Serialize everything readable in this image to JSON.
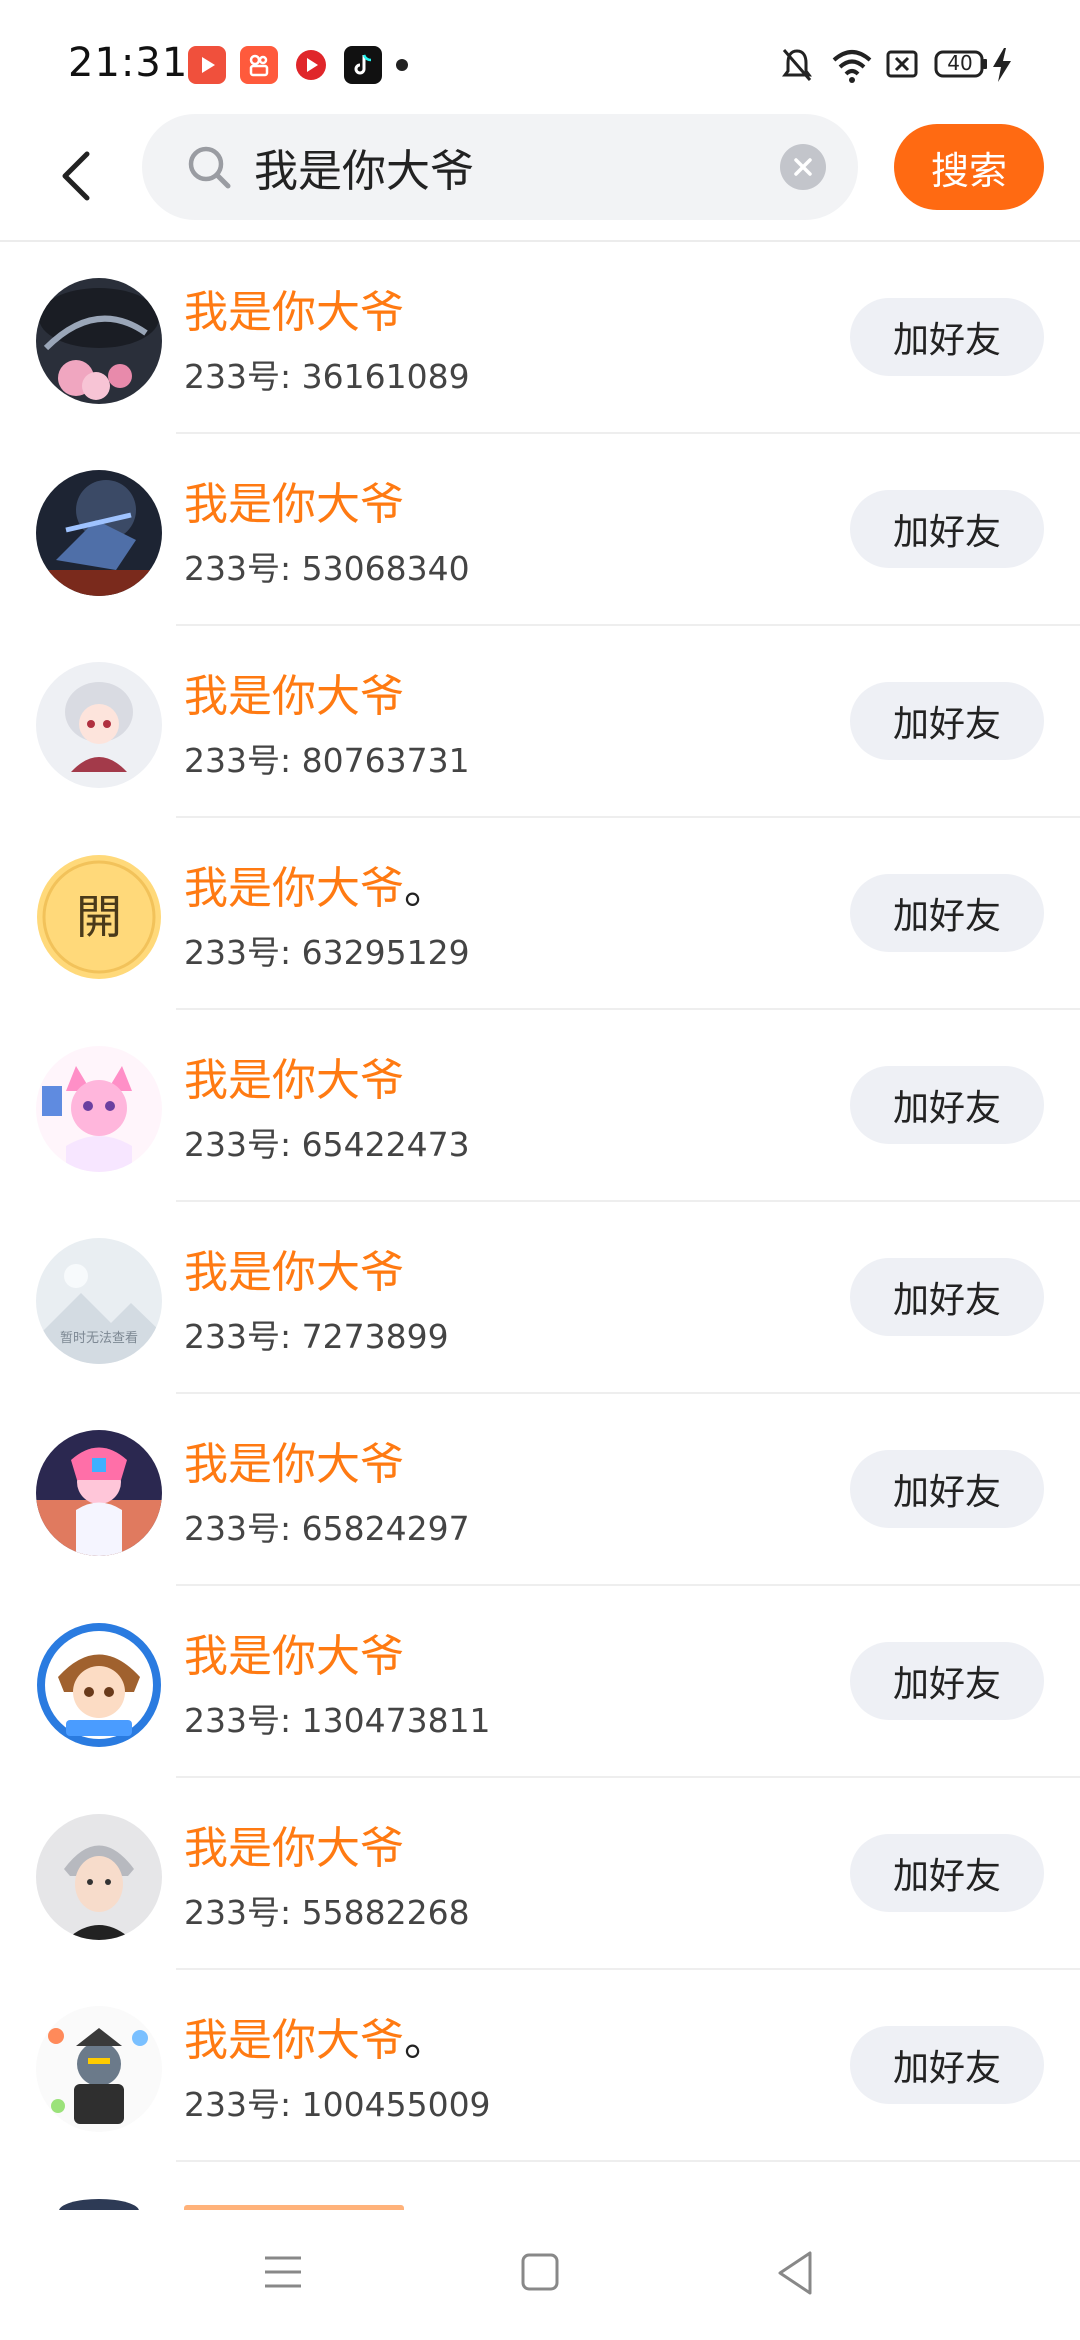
{
  "status": {
    "time": "21:31",
    "battery": "40"
  },
  "search": {
    "query": "我是你大爷",
    "button_label": "搜索"
  },
  "results": [
    {
      "name": "我是你大爷",
      "suffix": "",
      "uid": "233号: 36161089",
      "add_label": "加好友"
    },
    {
      "name": "我是你大爷",
      "suffix": "",
      "uid": "233号: 53068340",
      "add_label": "加好友"
    },
    {
      "name": "我是你大爷",
      "suffix": "",
      "uid": "233号: 80763731",
      "add_label": "加好友"
    },
    {
      "name": "我是你大爷",
      "suffix": "。",
      "uid": "233号: 63295129",
      "add_label": "加好友"
    },
    {
      "name": "我是你大爷",
      "suffix": "",
      "uid": "233号: 65422473",
      "add_label": "加好友"
    },
    {
      "name": "我是你大爷",
      "suffix": "",
      "uid": "233号: 7273899",
      "add_label": "加好友"
    },
    {
      "name": "我是你大爷",
      "suffix": "",
      "uid": "233号: 65824297",
      "add_label": "加好友"
    },
    {
      "name": "我是你大爷",
      "suffix": "",
      "uid": "233号: 130473811",
      "add_label": "加好友"
    },
    {
      "name": "我是你大爷",
      "suffix": "",
      "uid": "233号: 55882268",
      "add_label": "加好友"
    },
    {
      "name": "我是你大爷",
      "suffix": "。",
      "uid": "233号: 100455009",
      "add_label": "加好友"
    }
  ],
  "avatar_texts": {
    "open_char": "開",
    "placeholder_caption": "暂时无法查看"
  },
  "colors": {
    "accent": "#ff6a12",
    "name_highlight": "#ff7a12",
    "button_bg": "#eef0f5"
  }
}
